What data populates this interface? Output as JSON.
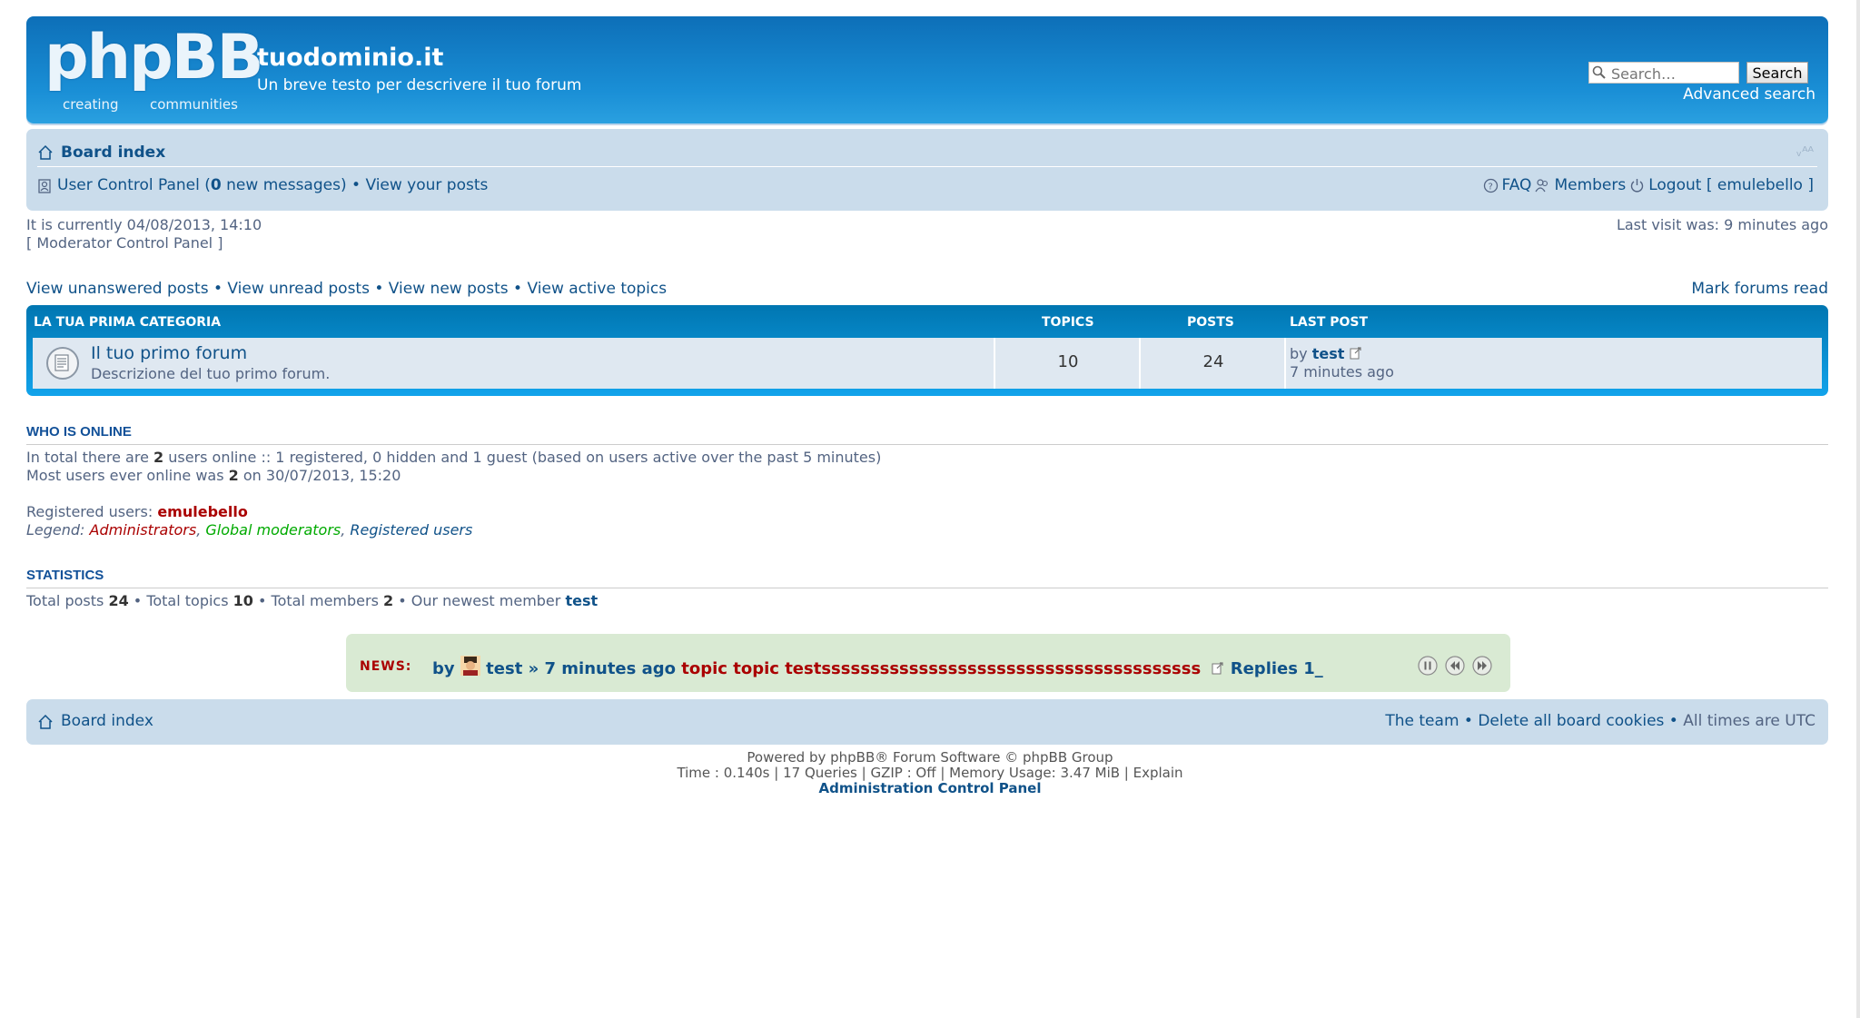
{
  "header": {
    "logo_text": "phpBB",
    "logo_reg": "®",
    "logo_tag1": "creating",
    "logo_tag2": "communities",
    "site_title": "tuodominio.it",
    "site_description": "Un breve testo per descrivere il tuo forum",
    "search_placeholder": "Search…",
    "search_button": "Search",
    "advanced_search": "Advanced search"
  },
  "navbar": {
    "board_index": "Board index",
    "font_size": "ᵥᴬᴬ",
    "ucp_prefix": "User Control Panel (",
    "ucp_count": "0",
    "ucp_suffix": " new messages)",
    "sep": " • ",
    "view_posts": "View your posts",
    "faq": "FAQ",
    "members": "Members",
    "logout": "Logout [ emulebello ]"
  },
  "status": {
    "current_time": "It is currently 04/08/2013, 14:10",
    "mcp": "[ Moderator Control Panel ]",
    "last_visit": "Last visit was: 9 minutes ago"
  },
  "quick_links": {
    "unanswered": "View unanswered posts",
    "unread": "View unread posts",
    "new_posts": "View new posts",
    "active": "View active topics",
    "sep": " • ",
    "mark_read": "Mark forums read"
  },
  "forum_table": {
    "category": "LA TUA PRIMA CATEGORIA",
    "col_topics": "TOPICS",
    "col_posts": "POSTS",
    "col_last_post": "LAST POST",
    "rows": [
      {
        "name": "Il tuo primo forum",
        "description": "Descrizione del tuo primo forum.",
        "topics": "10",
        "posts": "24",
        "last_by_prefix": "by ",
        "last_by_user": "test",
        "last_time": "7 minutes ago"
      }
    ]
  },
  "who_is_online": {
    "title": "WHO IS ONLINE",
    "line1_a": "In total there are ",
    "line1_count": "2",
    "line1_b": " users online :: 1 registered, 0 hidden and 1 guest (based on users active over the past 5 minutes)",
    "line2_a": "Most users ever online was ",
    "line2_count": "2",
    "line2_b": " on 30/07/2013, 15:20",
    "registered_label": "Registered users: ",
    "registered_user": "emulebello",
    "legend_label": "Legend: ",
    "legend_admin": "Administrators",
    "legend_gmod": "Global moderators",
    "legend_reg": "Registered users",
    "comma": ", "
  },
  "statistics": {
    "title": "STATISTICS",
    "posts_label": "Total posts ",
    "posts": "24",
    "topics_label": " • Total topics ",
    "topics": "10",
    "members_label": " • Total members ",
    "members": "2",
    "newest_label": " • Our newest member ",
    "newest": "test"
  },
  "news": {
    "label": "NEWS:",
    "by": "by ",
    "user": "test",
    "time": " » 7 minutes ago ",
    "topic": "topic topic testsssssssssssssssssssssssssssssssssssssss",
    "replies": " Replies 1_"
  },
  "footer": {
    "board_index": "Board index",
    "team": "The team",
    "sep": " • ",
    "delete_cookies": "Delete all board cookies",
    "timezone": "All times are UTC"
  },
  "copyright": {
    "line1": "Powered by phpBB® Forum Software © phpBB Group",
    "line2": "Time : 0.140s | 17 Queries | GZIP : Off | Memory Usage: 3.47 MiB | Explain",
    "acp": "Administration Control Panel"
  },
  "colors": {
    "header_blue": "#0d6fb8",
    "navbar_bg": "#cadceb",
    "link": "#105289",
    "admin_red": "#aa0000",
    "news_bg": "#d9ead3"
  }
}
